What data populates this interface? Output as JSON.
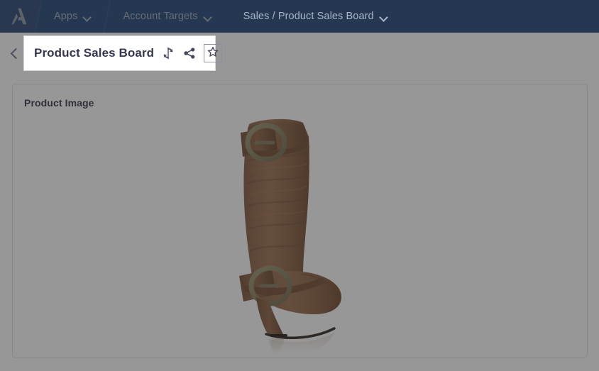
{
  "topnav": {
    "logo_icon": "anaplan-a-logo",
    "tabs": [
      {
        "label": "Apps",
        "caret_icon": "chevron-down-icon",
        "active": false
      },
      {
        "label": "Account Targets",
        "caret_icon": "chevron-down-icon",
        "active": false
      },
      {
        "label": "Sales / Product Sales Board",
        "caret_icon": "chevron-down-icon",
        "active": true
      }
    ],
    "background_color": "#1d3f72",
    "active_tab_color": "#102a4e",
    "text_color": "#9aa7bd"
  },
  "titlebar": {
    "back_icon": "chevron-left-icon",
    "title": "Product Sales Board",
    "refresh_icon": "refresh-icon",
    "share_icon": "share-icon",
    "favorite_icon": "star-icon"
  },
  "card": {
    "title": "Product Image",
    "image_alt": "brown-knee-high-buckle-boot",
    "border_color": "#e0e0e2"
  },
  "overlay": {
    "color": "#303030",
    "opacity": "0.50"
  }
}
